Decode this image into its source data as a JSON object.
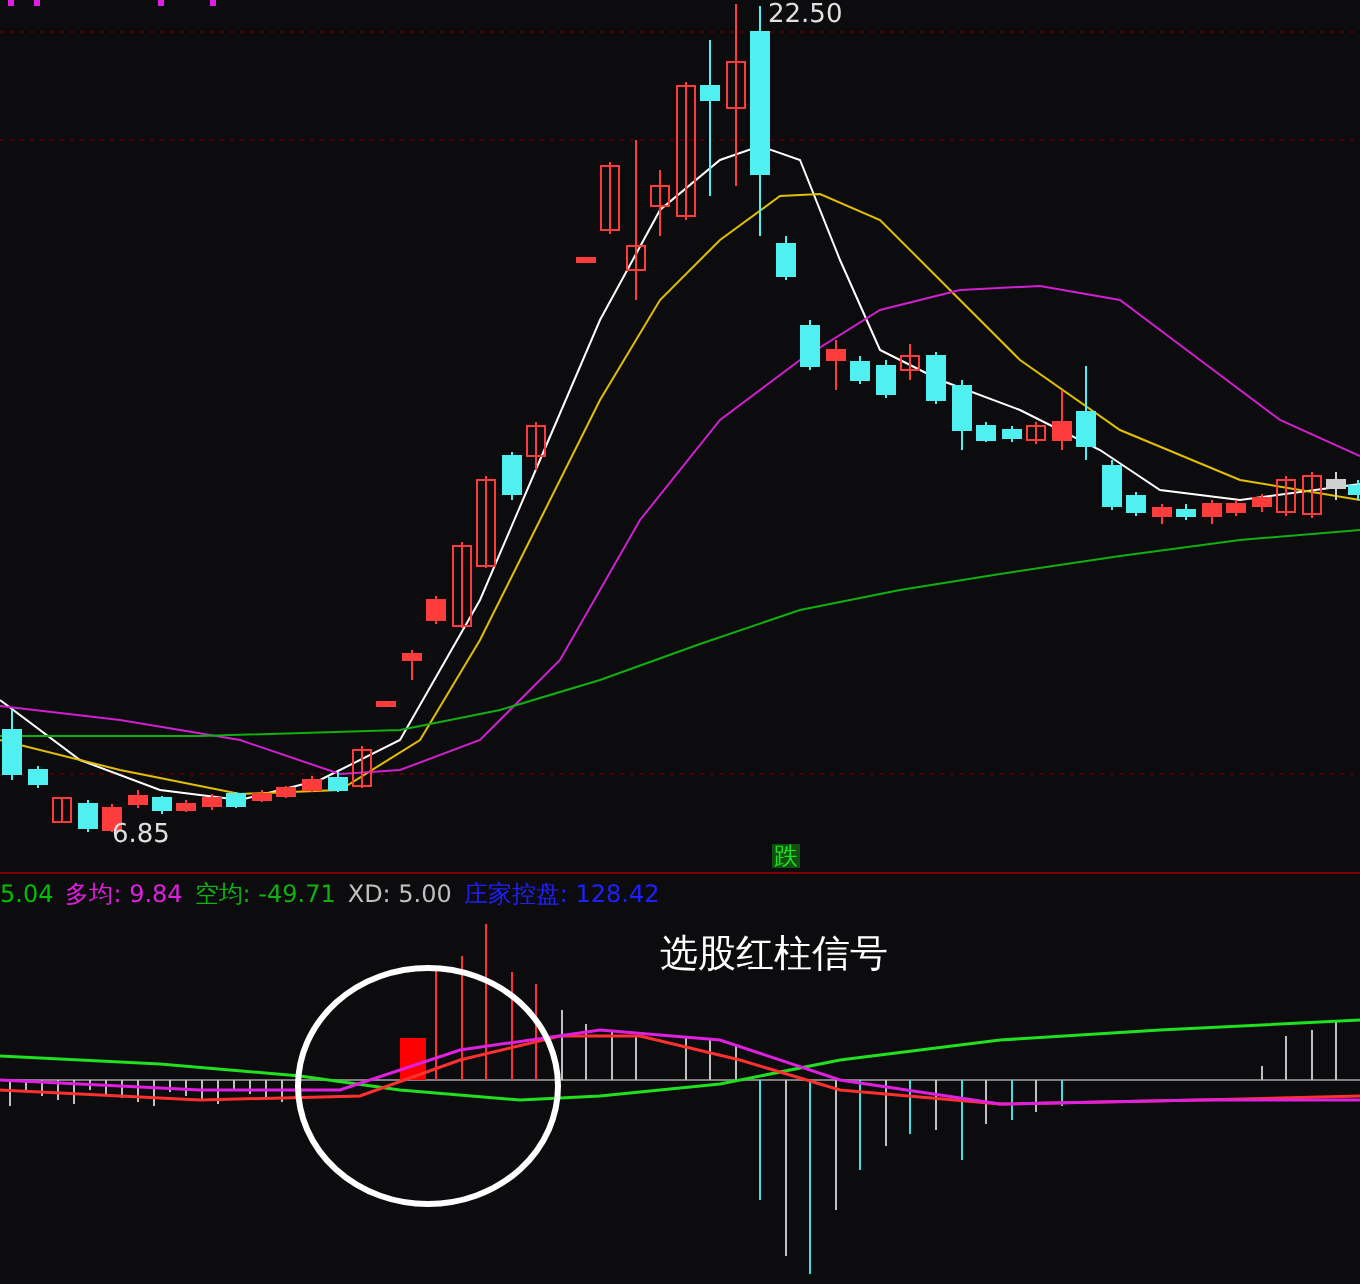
{
  "price_chart": {
    "high_label": "22.50",
    "low_label": "6.85",
    "signal_label": "跌"
  },
  "indicator": {
    "readouts": [
      {
        "text": "5.04",
        "color": "#00c000"
      },
      {
        "text": "多均: 9.84",
        "color": "#e020e0"
      },
      {
        "text": "空均: -49.71",
        "color": "#10b010"
      },
      {
        "text": "XD: 5.00",
        "color": "#c0c0c0"
      },
      {
        "text": "庄家控盘: 128.42",
        "color": "#2020ff"
      }
    ]
  },
  "annotation": {
    "text": "选股红柱信号"
  }
}
